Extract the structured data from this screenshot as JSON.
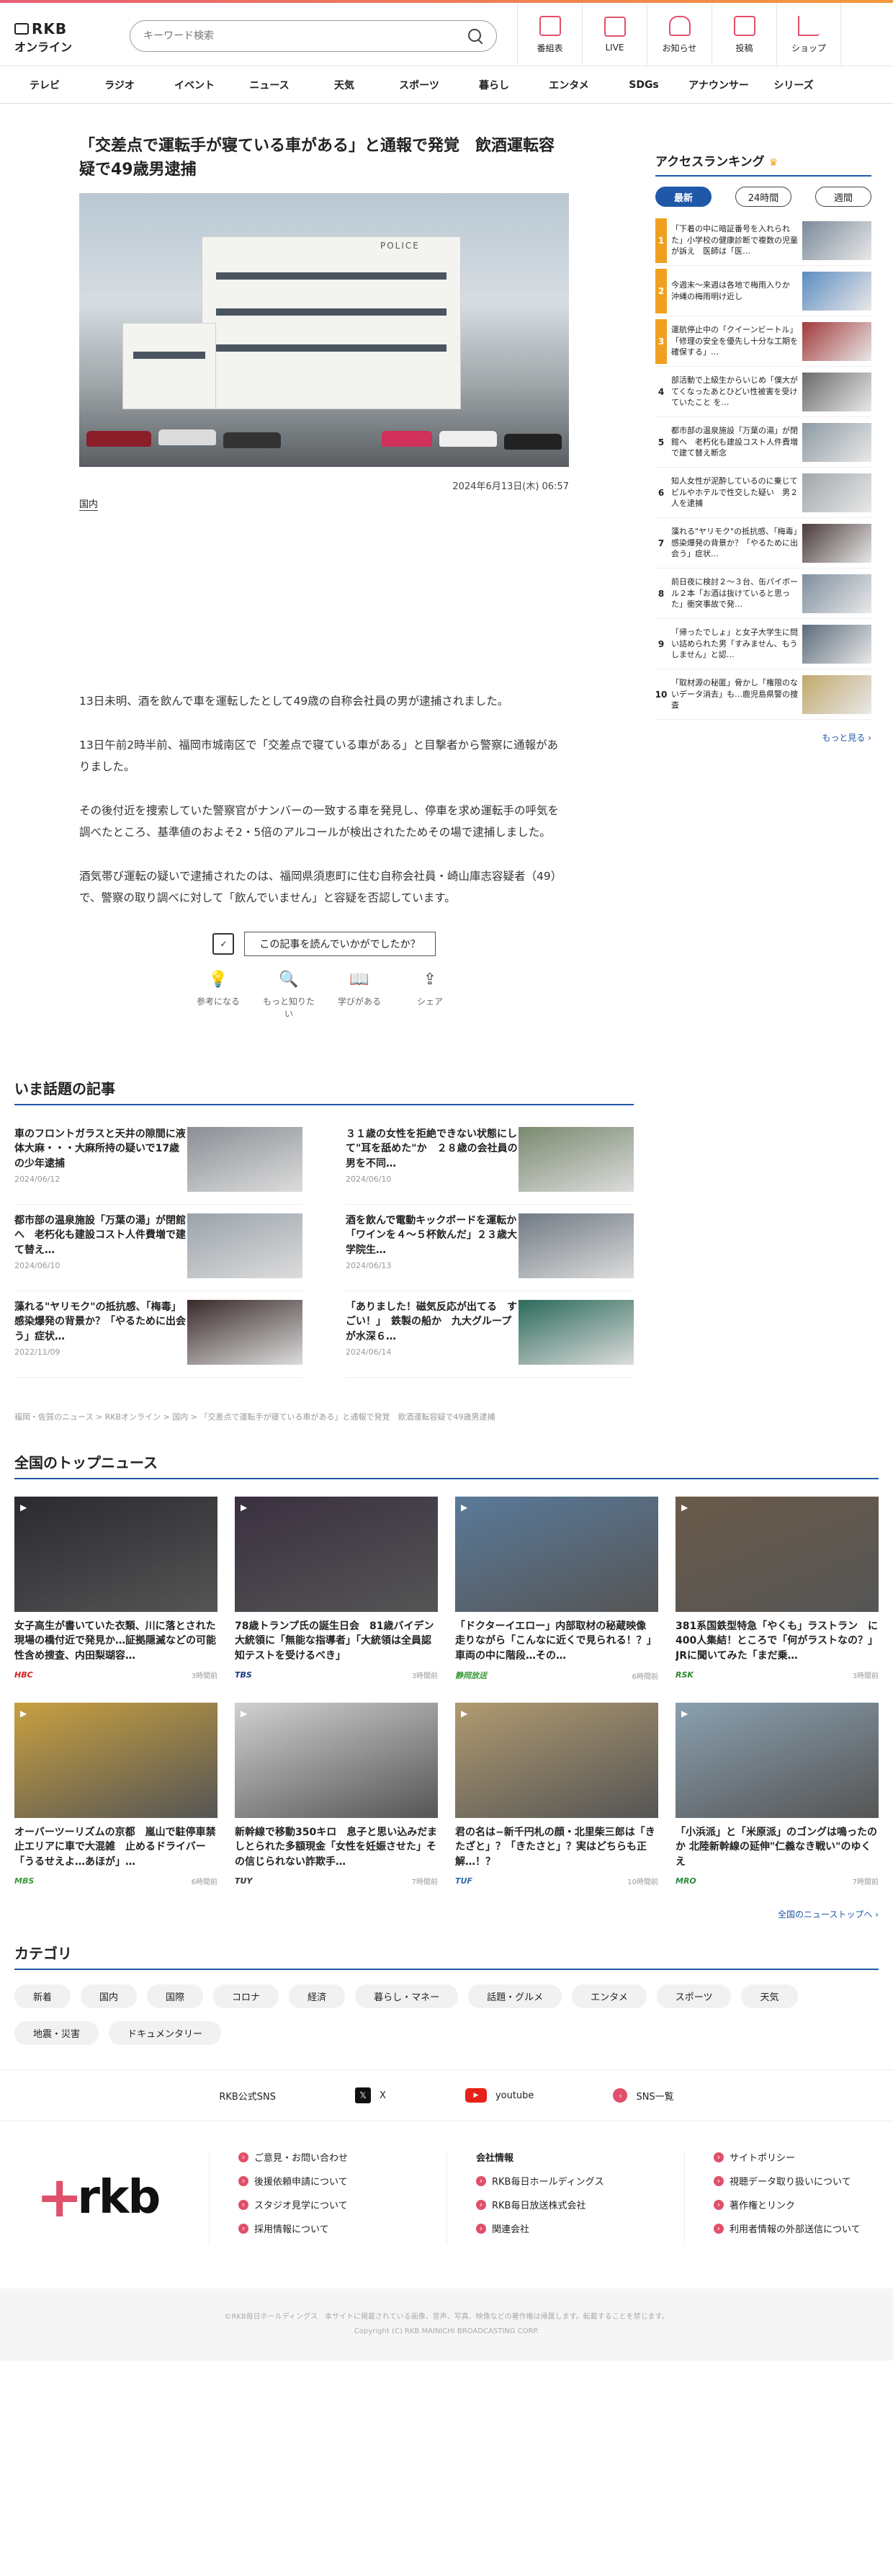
{
  "header": {
    "logo_line1": "RKB",
    "logo_line2": "オンライン",
    "search_placeholder": "キーワード検索",
    "nav": [
      {
        "label": "番組表",
        "icon": "calendar-icon"
      },
      {
        "label": "LIVE",
        "icon": "live-icon"
      },
      {
        "label": "お知らせ",
        "icon": "bell-icon"
      },
      {
        "label": "投稿",
        "icon": "pencil-icon"
      },
      {
        "label": "ショップ",
        "icon": "cart-icon"
      }
    ]
  },
  "categories_nav": [
    "テレビ",
    "ラジオ",
    "イベント",
    "ニュース",
    "天気",
    "スポーツ",
    "暮らし",
    "エンタメ",
    "SDGs",
    "アナウンサー",
    "シリーズ"
  ],
  "article": {
    "title": "「交差点で運転手が寝ている車がある」と通報で発覚　飲酒運転容疑で49歳男逮捕",
    "photo_sign": "POLICE",
    "date": "2024年6月13日(木) 06:57",
    "tag": "国内",
    "paragraphs": [
      "13日未明、酒を飲んで車を運転したとして49歳の自称会社員の男が逮捕されました。",
      "13日午前2時半前、福岡市城南区で「交差点で寝ている車がある」と目撃者から警察に通報がありました。",
      "その後付近を捜索していた警察官がナンバーの一致する車を発見し、停車を求め運転手の呼気を調べたところ、基準値のおよそ2・5倍のアルコールが検出されたためその場で逮捕しました。",
      "酒気帯び運転の疑いで逮捕されたのは、福岡県須恵町に住む自称会社員・崎山庫志容疑者（49）で、警察の取り調べに対して「飲んでいません」と容疑を否認しています。"
    ],
    "reaction_question": "この記事を読んでいかがでしたか？",
    "reactions": [
      {
        "label": "参考になる",
        "icon": "lightbulb-icon",
        "glyph": "💡"
      },
      {
        "label": "もっと知りたい",
        "icon": "magnifier-icon",
        "glyph": "🔍"
      },
      {
        "label": "学びがある",
        "icon": "book-icon",
        "glyph": "📖"
      },
      {
        "label": "シェア",
        "icon": "share-icon",
        "glyph": "⇪"
      }
    ]
  },
  "ranking": {
    "title": "アクセスランキング",
    "tabs": [
      "最新",
      "24時間",
      "週間"
    ],
    "items": [
      {
        "num": "1",
        "text": "「下着の中に暗証番号を入れられた」小学校の健康診断で複数の児童が訴え　医師は「医…",
        "color": "#7a8a9a"
      },
      {
        "num": "2",
        "text": "今週末〜来週は各地で梅雨入りか　沖縄の梅雨明け近し",
        "color": "#5d8cc0"
      },
      {
        "num": "3",
        "text": "運航停止中の「クイーンビートル」「修理の安全を優先し十分な工期を確保する」…",
        "color": "#a23a3a"
      },
      {
        "num": "4",
        "text": "部活動で上級生からいじめ「僕大がてくなったあとひどい性被害を受けていたこと を…",
        "color": "#6b6b6b"
      },
      {
        "num": "5",
        "text": "都市部の温泉施設「万葉の湯」が閉館へ　老朽化も建設コスト人件費増で建て替え断念",
        "color": "#8d9aa3"
      },
      {
        "num": "6",
        "text": "知人女性が泥酔しているのに乗じてビルやホテルで性交した疑い　男２人を逮捕",
        "color": "#a0a6ab"
      },
      {
        "num": "7",
        "text": "藻れる\"ヤリモク\"の抵抗感、「梅毒」感染爆発の背景か？「やるために出会う」症状…",
        "color": "#4a3a3a"
      },
      {
        "num": "8",
        "text": "前日夜に検討２〜３台、缶パイボール２本「お酒は抜けていると思った」衝突事故で発…",
        "color": "#7f8f9f"
      },
      {
        "num": "9",
        "text": "「帰ったでしょ」と女子大学生に問い詰められた男「すみません、もうしません」と認…",
        "color": "#5b6b7b"
      },
      {
        "num": "10",
        "text": "「取材源の秘匿」脅かし「権限のないデータ消去」も…鹿児島県警の捜査",
        "color": "#c2a86b"
      }
    ],
    "more": "もっと見る"
  },
  "trending": {
    "title": "いま話題の記事",
    "items": [
      {
        "title": "車のフロントガラスと天井の隙間に液体大麻・・・大麻所持の疑いで17歳の少年逮捕",
        "date": "2024/06/12",
        "color": "#8a8f95"
      },
      {
        "title": "３１歳の女性を拒絶できない状態にして\"耳を舐めた\"か　２８歳の会社員の男を不同…",
        "date": "2024/06/10",
        "color": "#7a8a70"
      },
      {
        "title": "都市部の温泉施設「万葉の湯」が閉館へ　老朽化も建設コスト人件費増で建て替え…",
        "date": "2024/06/10",
        "color": "#9aa3ab"
      },
      {
        "title": "酒を飲んで電動キックボードを運転か　「ワインを４〜５杯飲んだ」２３歳大学院生…",
        "date": "2024/06/13",
        "color": "#707a84"
      },
      {
        "title": "藻れる\"ヤリモク\"の抵抗感、「梅毒」感染爆発の背景か？「やるために出会う」症状…",
        "date": "2022/11/09",
        "color": "#3a2a2a"
      },
      {
        "title": "「ありました！磁気反応が出てる　すごい！」　鉄製の船か　九大グループが水深６…",
        "date": "2024/06/14",
        "color": "#2b6a5a"
      }
    ],
    "breadcrumb": "福岡・佐賀のニュース > RKBオンライン > 国内 > 「交差点で運転手が寝ている車がある」と通報で発覚　飲酒運転容疑で49歳男逮捕"
  },
  "national": {
    "title": "全国のトップニュース",
    "items": [
      {
        "title": "女子高生が書いていた衣類、川に落とされた現場の橋付近で発見か…証拠隠滅などの可能性含め捜査、内田梨瑚容…",
        "source": "HBC",
        "time": "3時間前",
        "src_color": "#d02020",
        "color": "#2a2a30"
      },
      {
        "title": "78歳トランプ氏の誕生日会　81歳バイデン大統領に「無能な指導者」「大統領は全員認知テストを受けるべき」",
        "source": "TBS",
        "time": "3時間前",
        "src_color": "#1a3a8a",
        "color": "#3a3040"
      },
      {
        "title": "「ドクターイエロー」内部取材の秘蔵映像　走りながら「こんなに近くで見られる！？」車両の中に階段…その…",
        "source": "静岡放送",
        "time": "6時間前",
        "src_color": "#3a9a3a",
        "color": "#5a7a9a"
      },
      {
        "title": "381系国鉄型特急「やくも」ラストラン　に400人集結！ところで「何がラストなの？」JRに聞いてみた「まだ乗…",
        "source": "RSK",
        "time": "3時間前",
        "src_color": "#2a8a2a",
        "color": "#6a5a4a"
      },
      {
        "title": "オーバーツーリズムの京都　嵐山で駐停車禁止エリアに車で大混雑　止めるドライバー「うるせえよ…あほが」…",
        "source": "MBS",
        "time": "6時間前",
        "src_color": "#3a9a3a",
        "color": "#c8a040"
      },
      {
        "title": "新幹線で移動350キロ　息子と思い込みだましとられた多額現金「女性を妊娠させた」その信じられない詐欺手…",
        "source": "TUY",
        "time": "7時間前",
        "src_color": "#333333",
        "color": "#d0d0d0"
      },
      {
        "title": "君の名は−新千円札の顔・北里柴三郎は「きたざと」？「きたさと」？実はどちらも正解…！？",
        "source": "TUF",
        "time": "10時間前",
        "src_color": "#2a6aaa",
        "color": "#b09a70"
      },
      {
        "title": "「小浜派」と「米原派」のゴングは鳴ったのか 北陸新幹線の延伸\"仁義なき戦い\"のゆくえ",
        "source": "MRO",
        "time": "7時間前",
        "src_color": "#2a8a3a",
        "color": "#8aa0b0"
      }
    ],
    "more": "全国のニューストップへ"
  },
  "category": {
    "title": "カテゴリ",
    "chips": [
      "新着",
      "国内",
      "国際",
      "コロナ",
      "経済",
      "暮らし・マネー",
      "話題・グルメ",
      "エンタメ",
      "スポーツ",
      "天気",
      "地震・災害",
      "ドキュメンタリー"
    ]
  },
  "sns": {
    "label": "RKB公式SNS",
    "x": "X",
    "youtube": "youtube",
    "all": "SNS一覧"
  },
  "footer": {
    "logo": "rkb",
    "col1": [
      "ご意見・お問い合わせ",
      "後援依頼申請について",
      "スタジオ見学について",
      "採用情報について"
    ],
    "col2_title": "会社情報",
    "col2": [
      "RKB毎日ホールディングス",
      "RKB毎日放送株式会社",
      "関連会社"
    ],
    "col3": [
      "サイトポリシー",
      "視聴データ取り扱いについて",
      "著作権とリンク",
      "利用者情報の外部送信について"
    ],
    "notice": "©RKB毎日ホールディングス　本サイトに掲載されている画像、音声、写真、映像などの著作権は帰属します。転載することを禁じます。",
    "copyright": "Copyright (C) RKB MAINICHI BROADCASTING CORP."
  }
}
